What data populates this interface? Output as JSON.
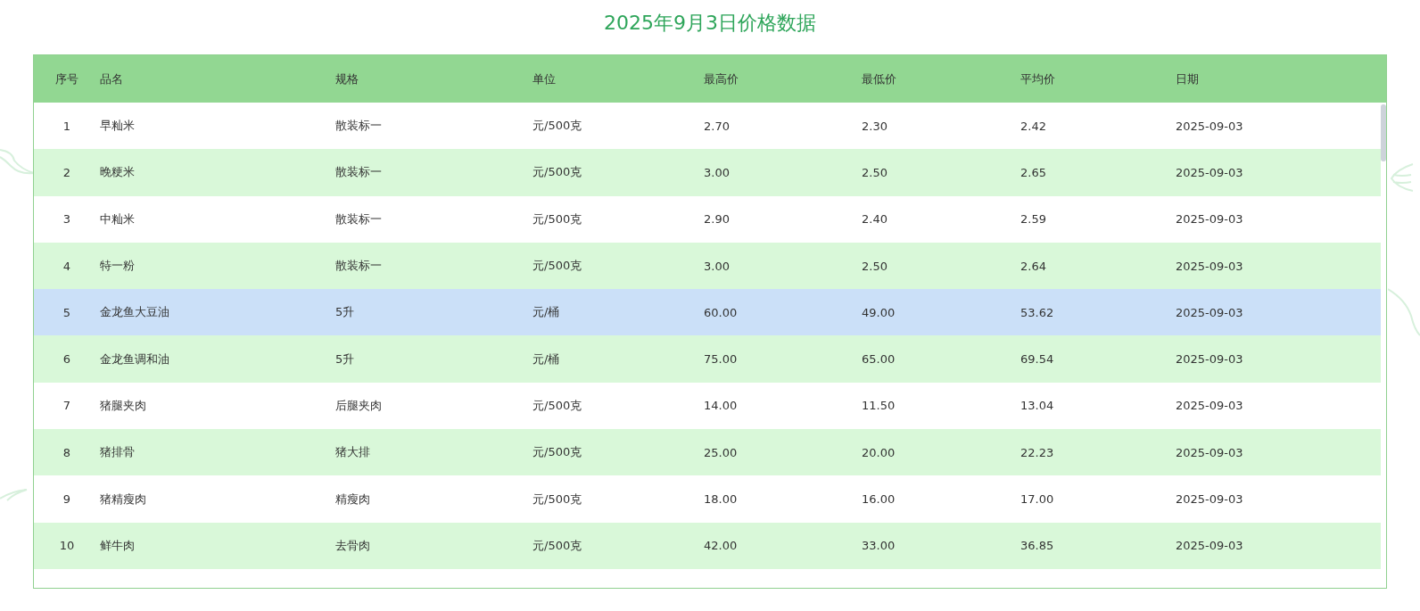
{
  "title": "2025年9月3日价格数据",
  "table": {
    "columns": [
      "序号",
      "品名",
      "规格",
      "单位",
      "最高价",
      "最低价",
      "平均价",
      "日期"
    ],
    "rows": [
      {
        "cells": [
          "1",
          "早籼米",
          "散装标一",
          "元/500克",
          "2.70",
          "2.30",
          "2.42",
          "2025-09-03"
        ],
        "selected": false
      },
      {
        "cells": [
          "2",
          "晚粳米",
          "散装标一",
          "元/500克",
          "3.00",
          "2.50",
          "2.65",
          "2025-09-03"
        ],
        "selected": false
      },
      {
        "cells": [
          "3",
          "中籼米",
          "散装标一",
          "元/500克",
          "2.90",
          "2.40",
          "2.59",
          "2025-09-03"
        ],
        "selected": false
      },
      {
        "cells": [
          "4",
          "特一粉",
          "散装标一",
          "元/500克",
          "3.00",
          "2.50",
          "2.64",
          "2025-09-03"
        ],
        "selected": false
      },
      {
        "cells": [
          "5",
          "金龙鱼大豆油",
          "5升",
          "元/桶",
          "60.00",
          "49.00",
          "53.62",
          "2025-09-03"
        ],
        "selected": true
      },
      {
        "cells": [
          "6",
          "金龙鱼调和油",
          "5升",
          "元/桶",
          "75.00",
          "65.00",
          "69.54",
          "2025-09-03"
        ],
        "selected": false
      },
      {
        "cells": [
          "7",
          "猪腿夹肉",
          "后腿夹肉",
          "元/500克",
          "14.00",
          "11.50",
          "13.04",
          "2025-09-03"
        ],
        "selected": false
      },
      {
        "cells": [
          "8",
          "猪排骨",
          "猪大排",
          "元/500克",
          "25.00",
          "20.00",
          "22.23",
          "2025-09-03"
        ],
        "selected": false
      },
      {
        "cells": [
          "9",
          "猪精瘦肉",
          "精瘦肉",
          "元/500克",
          "18.00",
          "16.00",
          "17.00",
          "2025-09-03"
        ],
        "selected": false
      },
      {
        "cells": [
          "10",
          "鲜牛肉",
          "去骨肉",
          "元/500克",
          "42.00",
          "33.00",
          "36.85",
          "2025-09-03"
        ],
        "selected": false
      }
    ]
  }
}
